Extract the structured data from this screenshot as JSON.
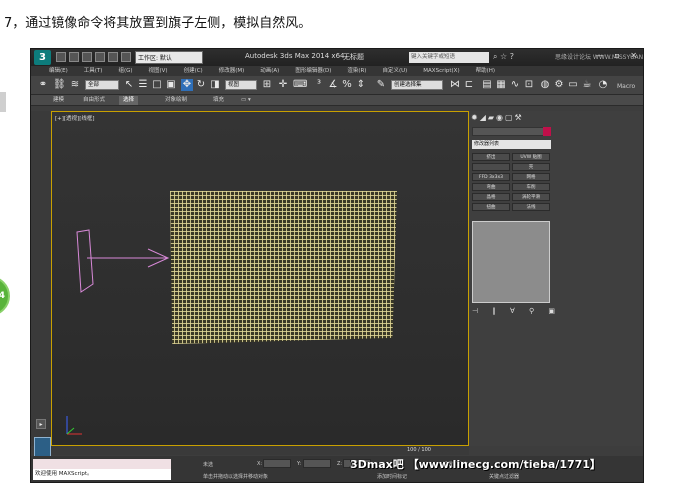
{
  "caption": "7，通过镜像命令将其放置到旗子左侧，模拟自然风。",
  "side_badge": "4",
  "titlebar": {
    "logo": "3",
    "workspace": "工作区: 默认",
    "app_title": "Autodesk 3ds Max  2014 x64",
    "doc_title": "无标题",
    "search_placeholder": "键入关键字或短语",
    "watermark": "思缘设计论坛  WWW.MISSYUAN.COM",
    "win_buttons": "— ▫ ✕"
  },
  "menus": [
    "编辑(E)",
    "工具(T)",
    "组(G)",
    "视图(V)",
    "创建(C)",
    "修改器(M)",
    "动画(A)",
    "图形编辑器(D)",
    "渲染(R)",
    "自定义(U)",
    "MAXScript(X)",
    "帮助(H)"
  ],
  "toolbar": {
    "filter_select": "全部",
    "view_select": "视图",
    "selection_set": "创建选择集",
    "macro_label": "Macro"
  },
  "ribbon": {
    "tabs": [
      "建模",
      "自由形式",
      "选择",
      "对象绘制",
      "填充"
    ],
    "active": 2
  },
  "viewport": {
    "label": "[+][透视][线框]"
  },
  "command_panel": {
    "modifier_list": "修改器列表",
    "buttons": [
      "挤出",
      "UVW 贴图",
      "",
      "壳",
      "FFD 3x3x3",
      "网格",
      "弯曲",
      "车削",
      "晶格",
      "涡轮平滑",
      "扭曲",
      "法线"
    ],
    "bottom_icons": "⊣ ‖ ∀ ⚲ ▣"
  },
  "timeline": {
    "frame": "100 / 100"
  },
  "status": {
    "maxscript_welcome": "欢迎使用 MAXScript。",
    "selected": "未选",
    "hint": "单击并拖动以选择并移动对象",
    "x_label": "X:",
    "y_label": "Y:",
    "z_label": "Z:",
    "add_time_tag": "添加时间标记",
    "set_key": "设置关键点",
    "key_filter": "关键点过滤器"
  },
  "watermark_bottom": "3Dmax吧 【www.linecg.com/tieba/1771】"
}
